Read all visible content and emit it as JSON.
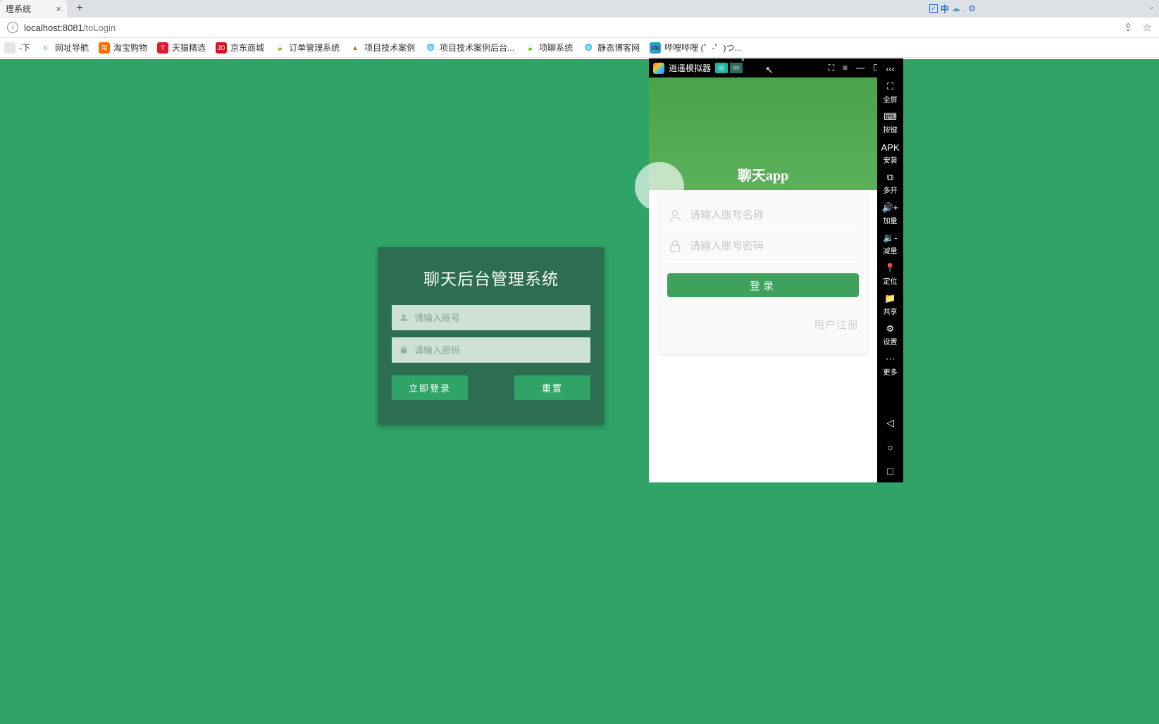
{
  "browser": {
    "tab_title": "理系统",
    "url_host": "localhost:",
    "url_port": "8081",
    "url_path": "/toLogin"
  },
  "status_icons": {
    "ime": "中"
  },
  "bookmarks": [
    {
      "label": "-下",
      "icon_bg": "#e5e5e5",
      "icon_txt": "",
      "icon_color": "#888"
    },
    {
      "label": "网址导航",
      "icon_bg": "#fff",
      "icon_txt": "h",
      "icon_color": "#3cb34a"
    },
    {
      "label": "淘宝购物",
      "icon_bg": "#ff6a00",
      "icon_txt": "淘",
      "icon_color": "#fff"
    },
    {
      "label": "天猫精选",
      "icon_bg": "#e11b2e",
      "icon_txt": "T",
      "icon_color": "#fff"
    },
    {
      "label": "京东商城",
      "icon_bg": "#d8121e",
      "icon_txt": "JD",
      "icon_color": "#fff"
    },
    {
      "label": "订单管理系统",
      "icon_bg": "#fff",
      "icon_txt": "🍃",
      "icon_color": "#3cb34a"
    },
    {
      "label": "项目技术案例",
      "icon_bg": "#fff",
      "icon_txt": "▲",
      "icon_color": "#b06a1b"
    },
    {
      "label": "项目技术案例后台...",
      "icon_bg": "#fff",
      "icon_txt": "🌐",
      "icon_color": "#888"
    },
    {
      "label": "项聊系统",
      "icon_bg": "#fff",
      "icon_txt": "🍃",
      "icon_color": "#3cb34a"
    },
    {
      "label": "静态博客网",
      "icon_bg": "#fff",
      "icon_txt": "🌐",
      "icon_color": "#888"
    },
    {
      "label": "哔哩哔哩 (゜-゜)つ...",
      "icon_bg": "#1ea0d6",
      "icon_txt": "📺",
      "icon_color": "#fff"
    }
  ],
  "login": {
    "title": "聊天后台管理系统",
    "account_placeholder": "请输入账号",
    "password_placeholder": "请输入密码",
    "submit": "立即登录",
    "reset": "重置"
  },
  "emulator": {
    "title": "逍遥模拟器",
    "app_title": "聊天app",
    "username_placeholder": "请输入账号名称",
    "password_placeholder": "请输入账号密码",
    "login": "登录",
    "register": "用户注册",
    "side": [
      {
        "icon": "⛶",
        "label": "全屏"
      },
      {
        "icon": "⌨",
        "label": "按键"
      },
      {
        "icon": "APK",
        "label": "安装"
      },
      {
        "icon": "⧉",
        "label": "多开"
      },
      {
        "icon": "🔊+",
        "label": "加量"
      },
      {
        "icon": "🔉-",
        "label": "减量"
      },
      {
        "icon": "📍",
        "label": "定位"
      },
      {
        "icon": "📁",
        "label": "共享"
      },
      {
        "icon": "⚙",
        "label": "设置"
      },
      {
        "icon": "⋯",
        "label": "更多"
      }
    ]
  }
}
